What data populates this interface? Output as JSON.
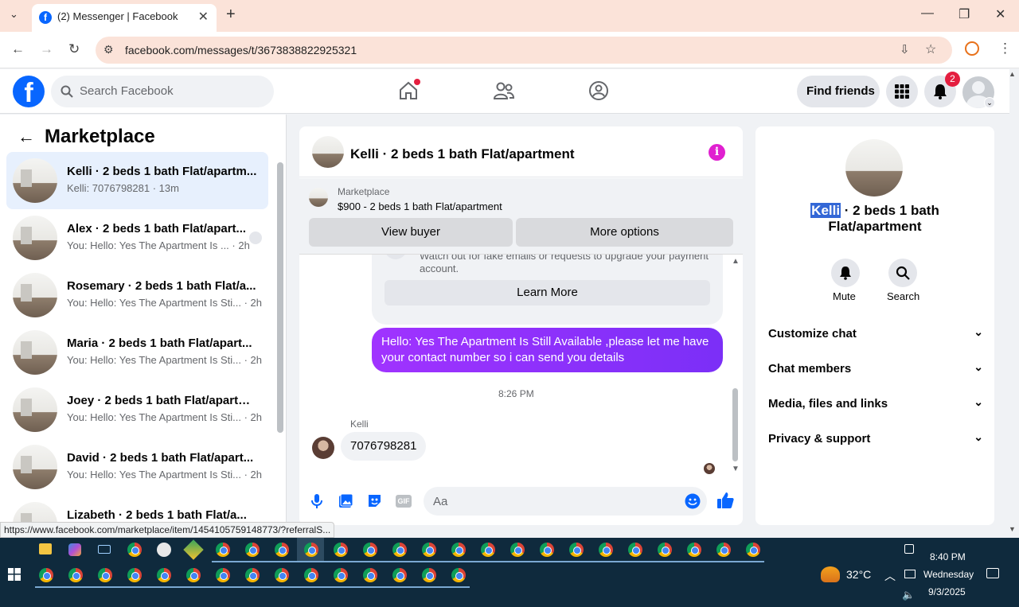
{
  "browser": {
    "tab_title": "(2) Messenger | Facebook",
    "tab_favicon": "f",
    "url": "facebook.com/messages/t/3673838822925321",
    "status_url": "https://www.facebook.com/marketplace/item/1454105759148773/?referralS..."
  },
  "fb_nav": {
    "search_placeholder": "Search Facebook",
    "find_friends": "Find friends",
    "notifications_count": "2",
    "logo": "f"
  },
  "left": {
    "title": "Marketplace",
    "conversations": [
      {
        "name": "Kelli · 2 beds 1 bath Flat/apartm...",
        "sub": "Kelli: 7076798281 · 13m",
        "active": true
      },
      {
        "name": "Alex · 2 beds 1 bath Flat/apart...",
        "sub": "You: Hello: Yes The Apartment Is ... · 2h"
      },
      {
        "name": "Rosemary · 2 beds 1 bath Flat/a...",
        "sub": "You: Hello: Yes The Apartment Is Sti... · 2h"
      },
      {
        "name": "Maria · 2 beds 1 bath Flat/apart...",
        "sub": "You: Hello: Yes The Apartment Is Sti... · 2h"
      },
      {
        "name": "Joey · 2 beds 1 bath Flat/apartm...",
        "sub": "You: Hello: Yes The Apartment Is Sti... · 2h"
      },
      {
        "name": "David · 2 beds 1 bath Flat/apart...",
        "sub": "You: Hello: Yes The Apartment Is Sti... · 2h"
      },
      {
        "name": "Lizabeth · 2 beds 1 bath Flat/a...",
        "sub": ""
      }
    ]
  },
  "chat": {
    "title": "Kelli · 2 beds 1 bath Flat/apartment",
    "listing_label": "Marketplace",
    "listing_price": "$900 - 2 beds 1 bath Flat/apartment",
    "view_buyer": "View buyer",
    "more_options": "More options",
    "warning_text": "Watch out for fake emails or requests to upgrade your payment account.",
    "learn_more": "Learn More",
    "outgoing": "Hello: Yes The Apartment Is Still Available ,please let me have your contact number so i can send you details",
    "timestamp": "8:26 PM",
    "incoming_sender": "Kelli",
    "incoming": "7076798281",
    "composer_placeholder": "Aa"
  },
  "right": {
    "name_highlight": "Kelli",
    "name_rest": " · 2 beds 1 bath Flat/apartment",
    "mute": "Mute",
    "search": "Search",
    "sections": [
      "Customize chat",
      "Chat members",
      "Media, files and links",
      "Privacy & support"
    ]
  },
  "taskbar": {
    "temperature": "32°C",
    "time": "8:40 PM",
    "day": "Wednesday",
    "date": "9/3/2025"
  },
  "colors": {
    "fb_blue": "#0866ff",
    "messenger_gradient_start": "#a033ff",
    "messenger_gradient_end": "#7b2ff7",
    "chrome_tint": "#fbe3d9",
    "notification_red": "#e41e3f",
    "info_magenta": "#e020d0"
  }
}
